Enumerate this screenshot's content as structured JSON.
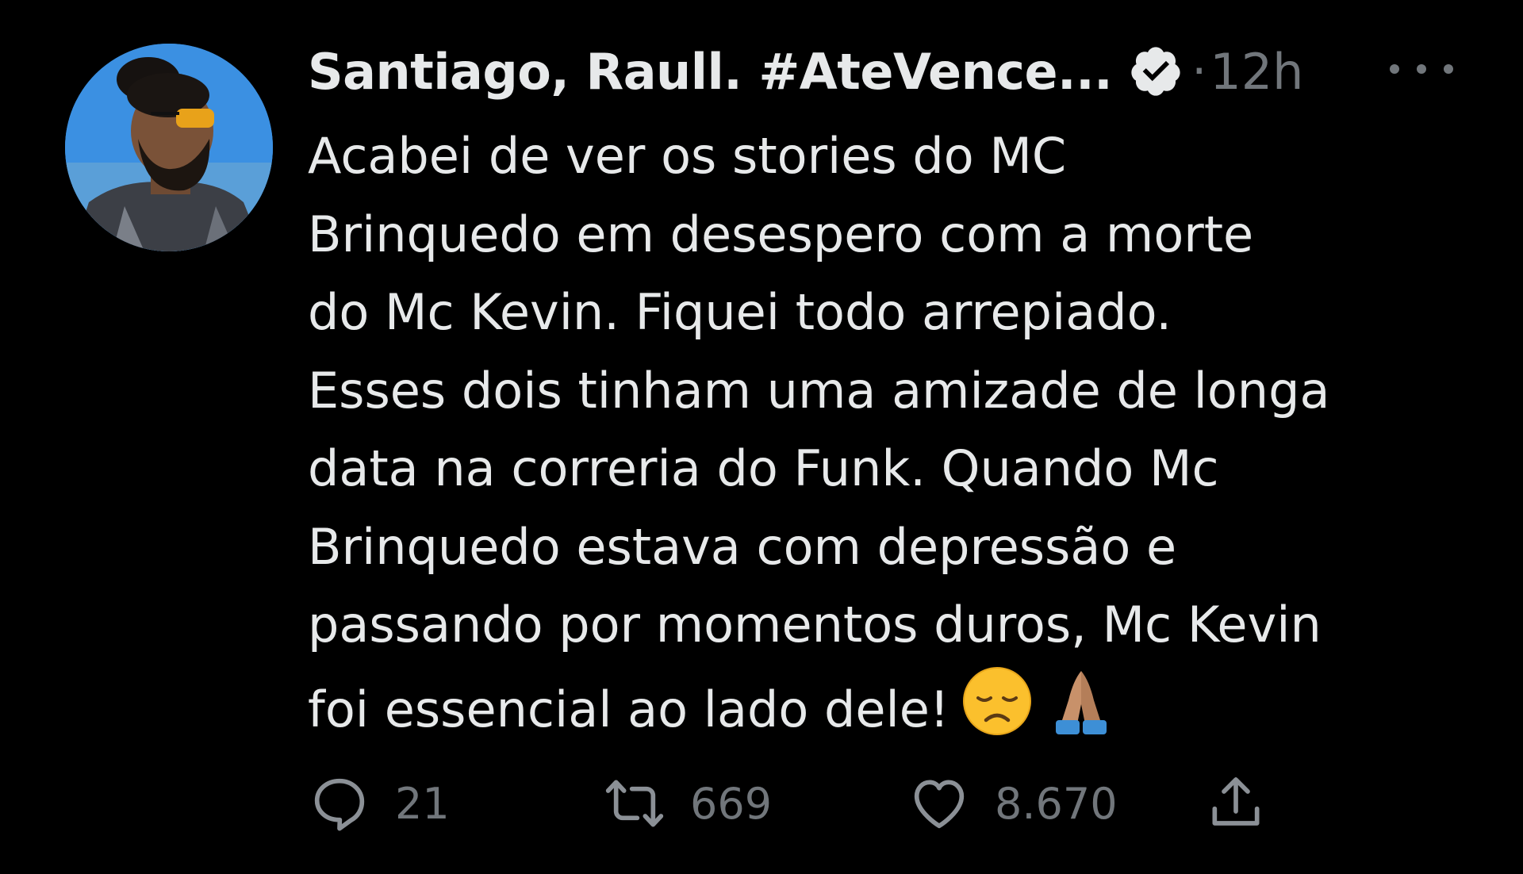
{
  "tweet": {
    "author": {
      "display_name": "Santiago, Raull. #AteVence...",
      "verified": true,
      "avatar_icon": "avatar-photo"
    },
    "separator": "·",
    "timestamp": "12h",
    "more_icon": "more-horizontal-icon",
    "text_lines": [
      "Acabei de ver os stories do MC",
      "Brinquedo em desespero com a morte",
      "do Mc Kevin. Fiquei todo arrepiado.",
      "Esses dois tinham uma amizade de longa",
      "data na correria do Funk. Quando Mc",
      "Brinquedo estava com depressão e",
      "passando por momentos duros, Mc Kevin",
      "foi essencial ao lado dele!"
    ],
    "emojis": [
      "disappointed-face",
      "folded-hands"
    ],
    "actions": {
      "reply": {
        "icon": "reply-icon",
        "count": "21"
      },
      "retweet": {
        "icon": "retweet-icon",
        "count": "669"
      },
      "like": {
        "icon": "heart-icon",
        "count": "8.670"
      },
      "share": {
        "icon": "share-icon"
      }
    }
  },
  "colors": {
    "background": "#000000",
    "text": "#e7e9ea",
    "muted": "#71767b"
  }
}
